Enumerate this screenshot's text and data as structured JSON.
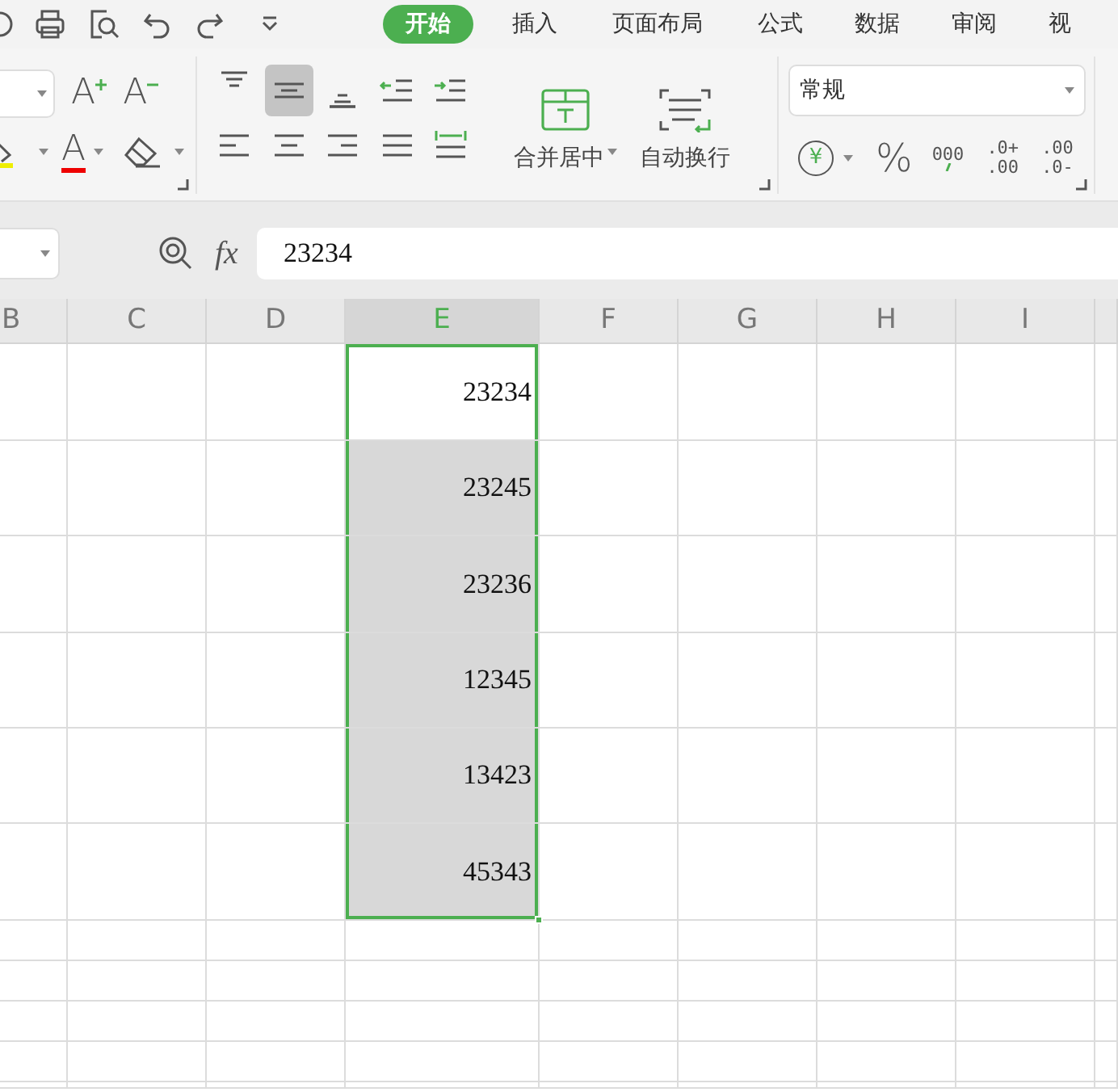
{
  "tabs": [
    {
      "label": "开始",
      "selected": true
    },
    {
      "label": "插入",
      "selected": false
    },
    {
      "label": "页面布局",
      "selected": false
    },
    {
      "label": "公式",
      "selected": false
    },
    {
      "label": "数据",
      "selected": false
    },
    {
      "label": "审阅",
      "selected": false
    },
    {
      "label": "视",
      "selected": false
    }
  ],
  "font_buttons": [
    {
      "kind": "grow",
      "symbol": "A"
    },
    {
      "kind": "shrink",
      "symbol": "A"
    },
    {
      "kind": "font_color",
      "symbol": "A"
    }
  ],
  "alignment_buttons": [
    {
      "kind": "top",
      "selected": false
    },
    {
      "kind": "middle",
      "selected": true
    },
    {
      "kind": "bottom",
      "selected": false
    },
    {
      "kind": "outdent",
      "selected": false
    },
    {
      "kind": "indent",
      "selected": false
    },
    {
      "kind": "left",
      "selected": false
    },
    {
      "kind": "center",
      "selected": false
    },
    {
      "kind": "right",
      "selected": false
    },
    {
      "kind": "justify",
      "selected": false
    },
    {
      "kind": "distributed",
      "selected": false
    }
  ],
  "merge_button": {
    "label": "合并居中"
  },
  "wrap_button": {
    "label": "自动换行"
  },
  "number_format": {
    "value": "常规"
  },
  "number_buttons": [
    {
      "kind": "currency",
      "symbol": "¥"
    },
    {
      "kind": "percent",
      "symbol": "%"
    },
    {
      "kind": "thousands",
      "symbol": "000"
    },
    {
      "kind": "increase_decimal",
      "top": ".0+",
      "bottom": ".00"
    },
    {
      "kind": "decrease_decimal",
      "top": ".00",
      "bottom": ".0-"
    }
  ],
  "formula_bar": {
    "fx_label": "fx",
    "value": "23234"
  },
  "columns": [
    {
      "label": "B",
      "selected": false
    },
    {
      "label": "C",
      "selected": false
    },
    {
      "label": "D",
      "selected": false
    },
    {
      "label": "E",
      "selected": true
    },
    {
      "label": "F",
      "selected": false
    },
    {
      "label": "G",
      "selected": false
    },
    {
      "label": "H",
      "selected": false
    },
    {
      "label": "I",
      "selected": false
    }
  ],
  "rows": [
    {
      "column_e": "23234",
      "selected": true,
      "active": true
    },
    {
      "column_e": "23245",
      "selected": true,
      "active": false
    },
    {
      "column_e": "23236",
      "selected": true,
      "active": false
    },
    {
      "column_e": "12345",
      "selected": true,
      "active": false
    },
    {
      "column_e": "13423",
      "selected": true,
      "active": false
    },
    {
      "column_e": "45343",
      "selected": true,
      "active": false
    }
  ]
}
